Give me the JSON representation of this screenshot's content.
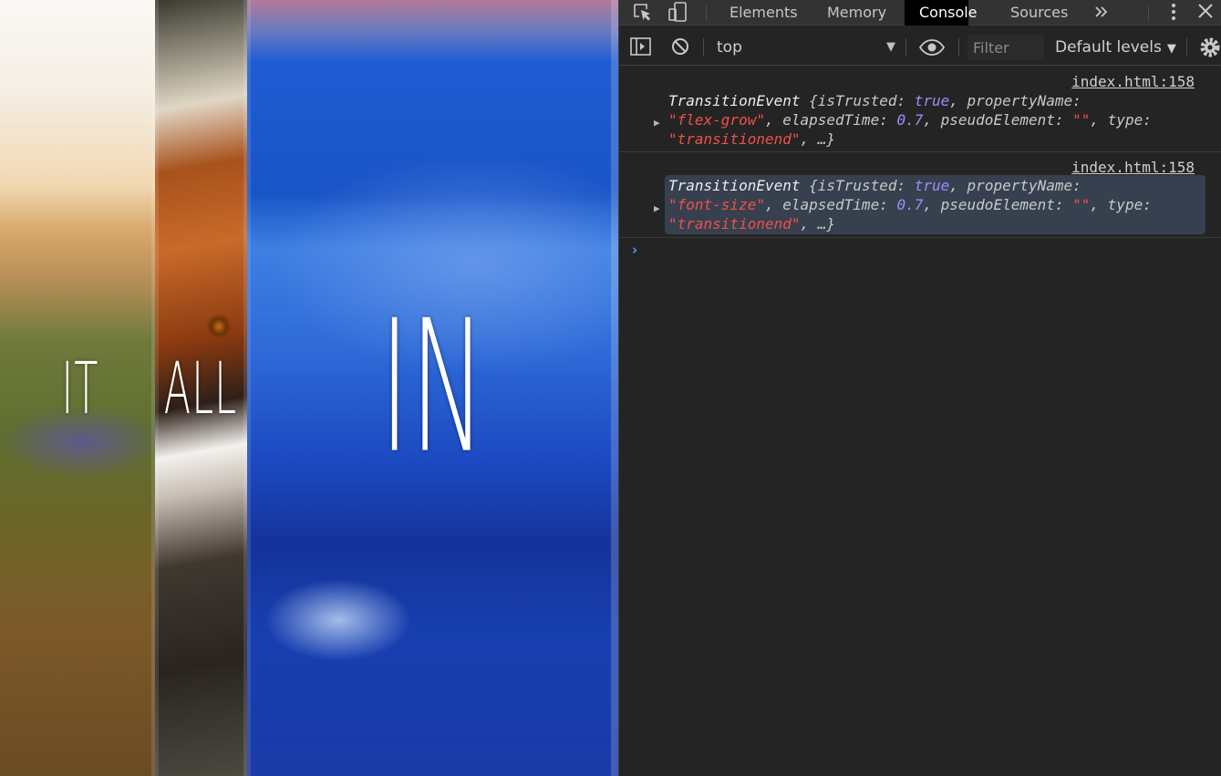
{
  "preview": {
    "panels": [
      {
        "word": "IT"
      },
      {
        "word": "ALL"
      },
      {
        "word": "IN"
      }
    ]
  },
  "devtools": {
    "tabs": [
      {
        "label": "Elements",
        "active": false
      },
      {
        "label": "Memory",
        "active": false
      },
      {
        "label": "Console",
        "active": true
      },
      {
        "label": "Sources",
        "active": false
      }
    ],
    "more_tabs_icon": "chevrons-right-icon",
    "toolbar": {
      "context": "top",
      "filter_placeholder": "Filter",
      "filter_value": "",
      "levels": "Default levels"
    },
    "messages": [
      {
        "source": "index.html:158",
        "object": "TransitionEvent",
        "is_trusted": "true",
        "property_name": "\"flex-grow\"",
        "elapsed_time": "0.7",
        "pseudo_element": "\"\"",
        "type": "\"transitionend\"",
        "selected": false
      },
      {
        "source": "index.html:158",
        "object": "TransitionEvent",
        "is_trusted": "true",
        "property_name": "\"font-size\"",
        "elapsed_time": "0.7",
        "pseudo_element": "\"\"",
        "type": "\"transitionend\"",
        "selected": true
      }
    ],
    "labels": {
      "obj_open": "{",
      "is_trusted_key": "isTrusted: ",
      "comma": ", ",
      "property_name_key": "propertyName: ",
      "elapsed_time_key": "elapsedTime: ",
      "pseudo_element_key": "pseudoElement: ",
      "type_key": "type: ",
      "ellipsis_close": ", …}"
    },
    "prompt_glyph": "›"
  },
  "colors": {
    "devtools_bg": "#242424",
    "tab_active_bg": "#000000",
    "string": "#f0504a",
    "keyword": "#9f8cff",
    "selection": "#37404e",
    "prompt": "#4aa3ff"
  }
}
